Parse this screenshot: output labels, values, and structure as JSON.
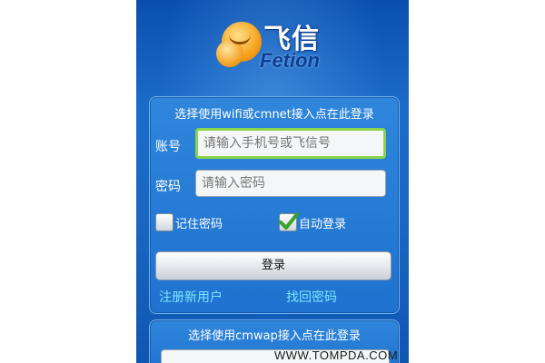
{
  "watermark": {
    "text": "WWW.TOMPDA.COM"
  },
  "logo": {
    "chinese": "飞信",
    "english": "Fetion"
  },
  "wifi_panel": {
    "title": "选择使用wifi或cmnet接入点在此登录",
    "account_label": "账号",
    "account_placeholder": "请输入手机号或飞信号",
    "password_label": "密码",
    "password_placeholder": "请输入密码",
    "remember_label": "记住密码",
    "remember_checked": false,
    "auto_login_label": "自动登录",
    "auto_login_checked": true,
    "login_button": "登录",
    "register_link": "注册新用户",
    "retrieve_link": "找回密码"
  },
  "wap_panel": {
    "title": "选择使用cmwap接入点在此登录"
  },
  "colors": {
    "background_blue": "#1b6cc9",
    "link_cyan": "#7fe6ff",
    "focus_green": "#8ad44a",
    "logo_orange": "#f6a21b"
  }
}
